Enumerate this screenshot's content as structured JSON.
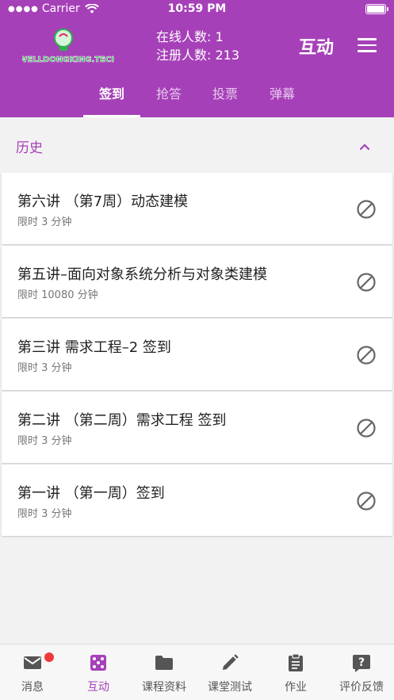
{
  "status_bar": {
    "carrier": "Carrier",
    "time": "10:59 PM",
    "battery_level": 1.0
  },
  "header": {
    "logo_text": "WELLDONGKING.TECH",
    "online_count": "在线人数: 1",
    "registered_count": "注册人数: 213",
    "title": "互动"
  },
  "tabs": [
    {
      "label": "签到",
      "active": true
    },
    {
      "label": "抢答",
      "active": false
    },
    {
      "label": "投票",
      "active": false
    },
    {
      "label": "弹幕",
      "active": false
    }
  ],
  "section": {
    "title": "历史"
  },
  "items": [
    {
      "title": "第六讲 （第7周）动态建模",
      "subtitle": "限时 3 分钟"
    },
    {
      "title": "第五讲–面向对象系统分析与对象类建模",
      "subtitle": "限时 10080 分钟"
    },
    {
      "title": "第三讲 需求工程–2 签到",
      "subtitle": "限时 3 分钟"
    },
    {
      "title": "第二讲 （第二周）需求工程 签到",
      "subtitle": "限时 3 分钟"
    },
    {
      "title": "第一讲 （第一周）签到",
      "subtitle": "限时 3 分钟"
    }
  ],
  "bottom_nav": [
    {
      "label": "消息",
      "icon": "mail-icon",
      "badge": true
    },
    {
      "label": "互动",
      "icon": "dice-icon",
      "active": true
    },
    {
      "label": "课程资料",
      "icon": "folder-icon"
    },
    {
      "label": "课堂测试",
      "icon": "pencil-icon"
    },
    {
      "label": "作业",
      "icon": "clipboard-icon"
    },
    {
      "label": "评价反馈",
      "icon": "help-icon"
    }
  ],
  "colors": {
    "primary": "#a640b8",
    "badge": "#f0393a",
    "background": "#f2f2f2"
  }
}
